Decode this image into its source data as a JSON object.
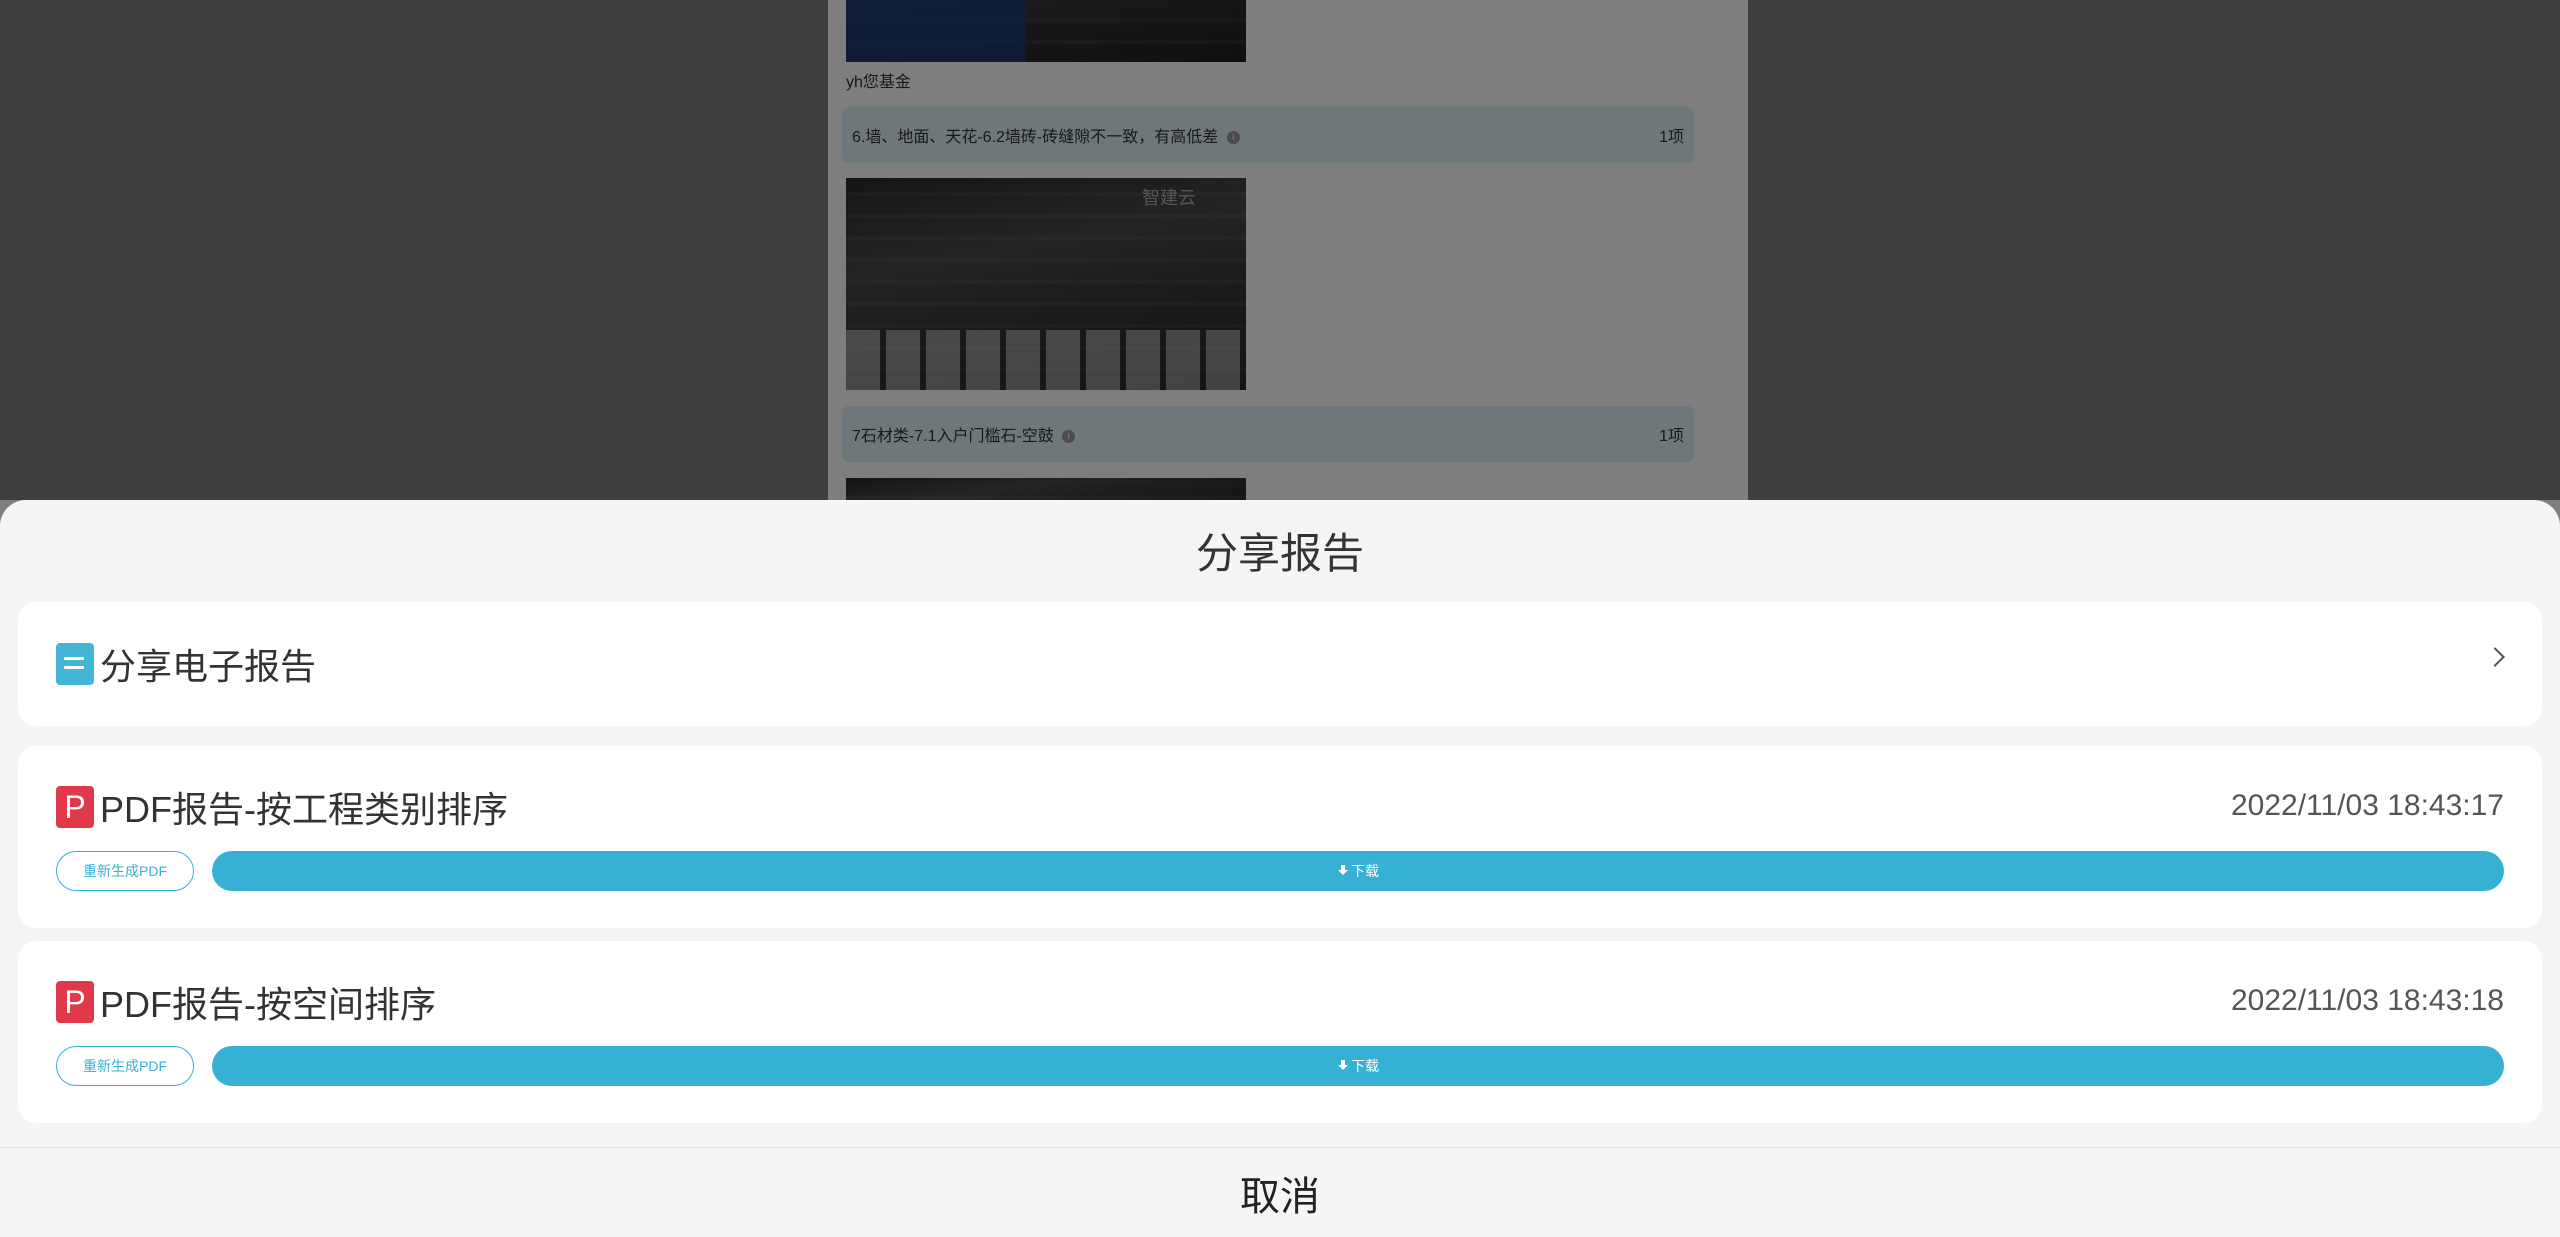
{
  "background": {
    "caption": "yh您基金",
    "issues": [
      {
        "text": "6.墙、地面、天花-6.2墙砖-砖缝隙不一致，有高低差",
        "count": "1项"
      },
      {
        "text": "7石材类-7.1入户门槛石-空鼓",
        "count": "1项"
      }
    ],
    "watermark": "智建云"
  },
  "sheet": {
    "title": "分享报告",
    "share_label": "分享电子报告",
    "pdf_icon_letter": "P",
    "reports": [
      {
        "label": "PDF报告-按工程类别排序",
        "timestamp": "2022/11/03 18:43:17",
        "regen_label": "重新生成PDF",
        "download_label": "下载"
      },
      {
        "label": "PDF报告-按空间排序",
        "timestamp": "2022/11/03 18:43:18",
        "regen_label": "重新生成PDF",
        "download_label": "下载"
      }
    ],
    "cancel_label": "取消"
  },
  "colors": {
    "accent": "#36b1d4",
    "pdf_red": "#e03a4a",
    "share_blue": "#45b5d6"
  }
}
